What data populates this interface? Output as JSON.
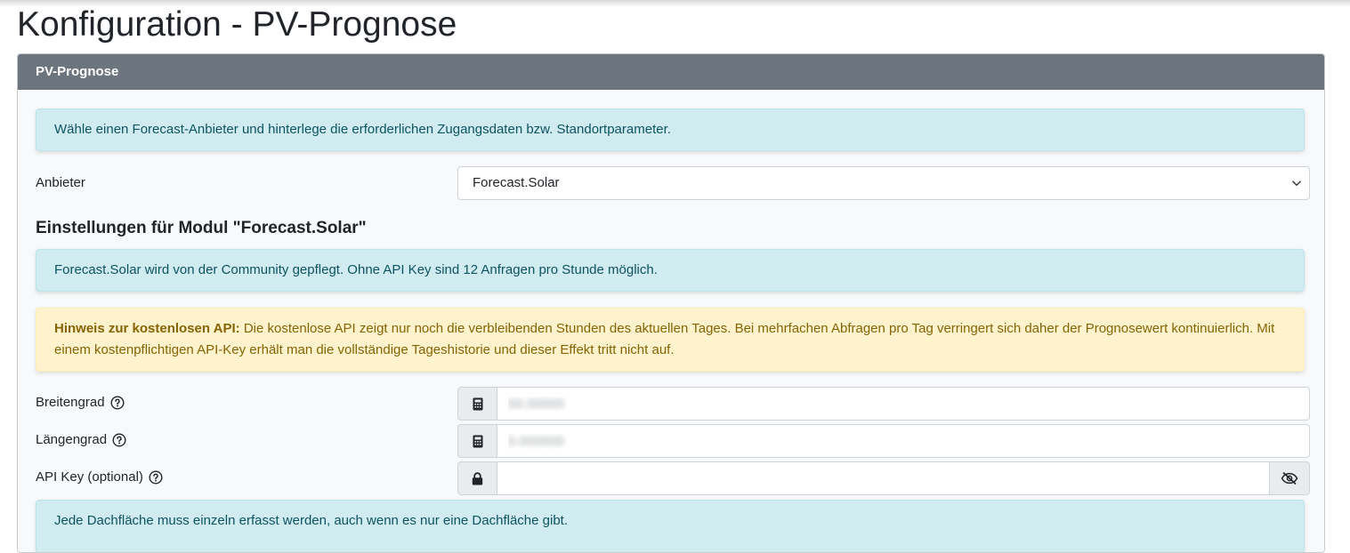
{
  "page": {
    "title": "Konfiguration - PV-Prognose"
  },
  "card": {
    "header": "PV-Prognose",
    "intro_alert": "Wähle einen Forecast-Anbieter und hinterlege die erforderlichen Zugangsdaten bzw. Standortparameter.",
    "provider": {
      "label": "Anbieter",
      "selected": "Forecast.Solar"
    },
    "module_title": "Einstellungen für Modul \"Forecast.Solar\"",
    "module_info": "Forecast.Solar wird von der Community gepflegt. Ohne API Key sind 12 Anfragen pro Stunde möglich.",
    "warning": {
      "strong": "Hinweis zur kostenlosen API:",
      "text": " Die kostenlose API zeigt nur noch die verbleibenden Stunden des aktuellen Tages. Bei mehrfachen Abfragen pro Tag verringert sich daher der Prognosewert kontinuierlich. Mit einem kostenpflichtigen API-Key erhält man die vollständige Tageshistorie und dieser Effekt tritt nicht auf."
    },
    "fields": {
      "latitude": {
        "label": "Breitengrad",
        "value": "00.00000",
        "icon": "calculator-icon"
      },
      "longitude": {
        "label": "Längengrad",
        "value": "0.000000",
        "icon": "calculator-icon"
      },
      "api_key": {
        "label": "API Key (optional)",
        "value": "",
        "icon": "lock-icon",
        "toggle_icon": "eye-slash-icon"
      }
    },
    "roof_info": "Jede Dachfläche muss einzeln erfasst werden, auch wenn es nur eine Dachfläche gibt."
  },
  "colors": {
    "header_bg": "#6c757d",
    "info_bg": "#d1ecf1",
    "info_text": "#0c5460",
    "warning_bg": "#fff3cd",
    "warning_text": "#856404"
  }
}
